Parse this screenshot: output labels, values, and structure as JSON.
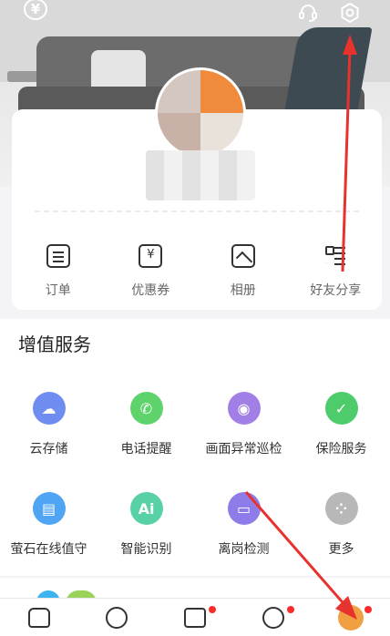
{
  "header": {
    "icons": [
      "yuan-icon",
      "headset-icon",
      "settings-icon"
    ]
  },
  "shortcuts": [
    {
      "label": "订单",
      "icon": "order-icon"
    },
    {
      "label": "优惠券",
      "icon": "coupon-icon"
    },
    {
      "label": "相册",
      "icon": "album-icon"
    },
    {
      "label": "好友分享",
      "icon": "share-icon"
    }
  ],
  "services": {
    "title": "增值服务",
    "items": [
      {
        "label": "云存储",
        "icon": "cloud-icon",
        "color": "#6f8cf0"
      },
      {
        "label": "电话提醒",
        "icon": "phone-icon",
        "color": "#5fd36b"
      },
      {
        "label": "画面异常巡检",
        "icon": "camera-check-icon",
        "color": "#a27fe6"
      },
      {
        "label": "保险服务",
        "icon": "shield-icon",
        "color": "#4ecb6a"
      },
      {
        "label": "萤石在线值守",
        "icon": "store-icon",
        "color": "#4fa4f3"
      },
      {
        "label": "智能识别",
        "icon": "ai-icon",
        "color": "#58d1a5"
      },
      {
        "label": "离岗检测",
        "icon": "monitor-icon",
        "color": "#8e7ce8"
      },
      {
        "label": "更多",
        "icon": "more-icon",
        "color": "#b8b8b8"
      }
    ]
  },
  "tabbar": [
    {
      "name": "home",
      "dot": false
    },
    {
      "name": "flash",
      "dot": false
    },
    {
      "name": "bag",
      "dot": true
    },
    {
      "name": "discover",
      "dot": true
    },
    {
      "name": "me",
      "dot": true
    }
  ]
}
